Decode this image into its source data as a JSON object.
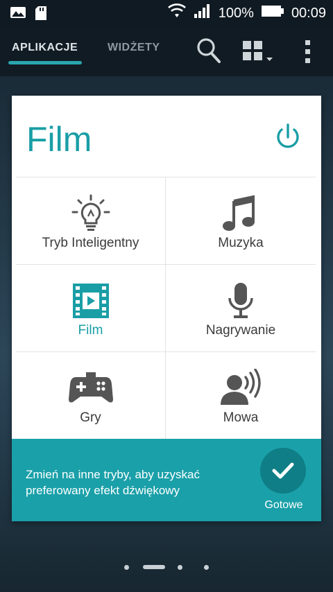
{
  "status_bar": {
    "battery": "100%",
    "time": "00:09",
    "icons": [
      "image-notification-icon",
      "sd-card-icon",
      "wifi-icon",
      "signal-icon",
      "battery-icon"
    ]
  },
  "app_bar": {
    "tabs": [
      {
        "label": "APLIKACJE",
        "active": true
      },
      {
        "label": "WIDŻETY",
        "active": false
      }
    ],
    "icons": [
      "search-icon",
      "grid-view-icon",
      "overflow-menu-icon"
    ]
  },
  "dialog": {
    "title": "Film",
    "modes": [
      {
        "label": "Tryb Inteligentny",
        "icon": "lightbulb-icon",
        "active": false
      },
      {
        "label": "Muzyka",
        "icon": "music-note-icon",
        "active": false
      },
      {
        "label": "Film",
        "icon": "film-icon",
        "active": true
      },
      {
        "label": "Nagrywanie",
        "icon": "microphone-icon",
        "active": false
      },
      {
        "label": "Gry",
        "icon": "gamepad-icon",
        "active": false
      },
      {
        "label": "Mowa",
        "icon": "speech-icon",
        "active": false
      }
    ],
    "hint": "Zmień na inne tryby, aby uzyskać preferowany efekt dźwiękowy",
    "done_label": "Gotowe"
  },
  "colors": {
    "accent": "#1a9ea6",
    "footer": "#1aa0a9",
    "done_button": "#0f7e86",
    "tab_underline": "#2aa6ad"
  }
}
